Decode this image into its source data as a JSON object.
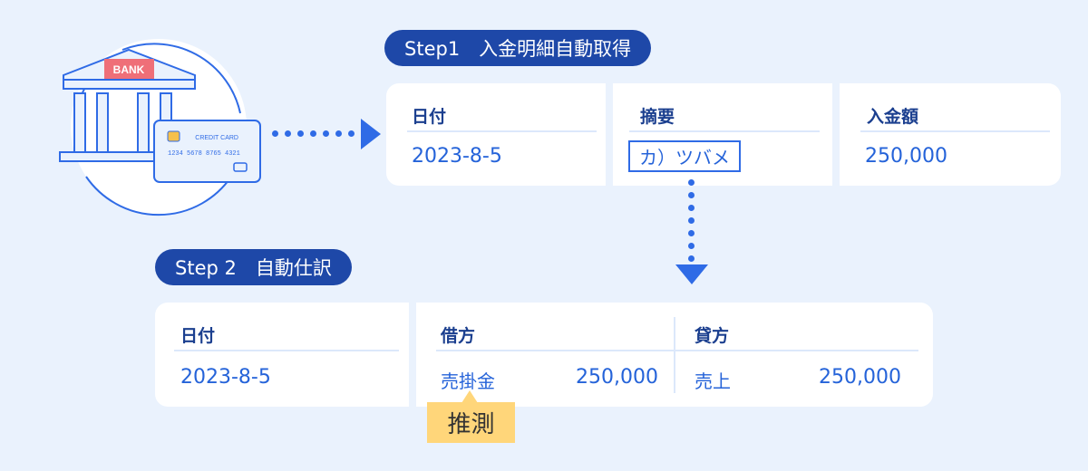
{
  "illustration": {
    "bank_sign": "BANK",
    "card_label": "CREDIT CARD",
    "card_number": "1234 5678 8765 4321"
  },
  "step1": {
    "title": "Step1　入金明細自動取得",
    "columns": [
      {
        "header": "日付",
        "value": "2023-8-5"
      },
      {
        "header": "摘要",
        "value": "カ）ツバメ"
      },
      {
        "header": "入金額",
        "value": "250,000"
      }
    ]
  },
  "step2": {
    "title": "Step 2　自動仕訳",
    "date": {
      "header": "日付",
      "value": "2023-8-5"
    },
    "debit": {
      "header": "借方",
      "account": "売掛金",
      "amount": "250,000"
    },
    "credit": {
      "header": "貸方",
      "account": "売上",
      "amount": "250,000"
    },
    "badge": "推測"
  },
  "colors": {
    "background": "#eaf2fd",
    "pill": "#1e48a8",
    "accent": "#2563d9",
    "header_text": "#1b3f8f",
    "badge": "#ffd67a",
    "bank_sign": "#ef6f78"
  }
}
